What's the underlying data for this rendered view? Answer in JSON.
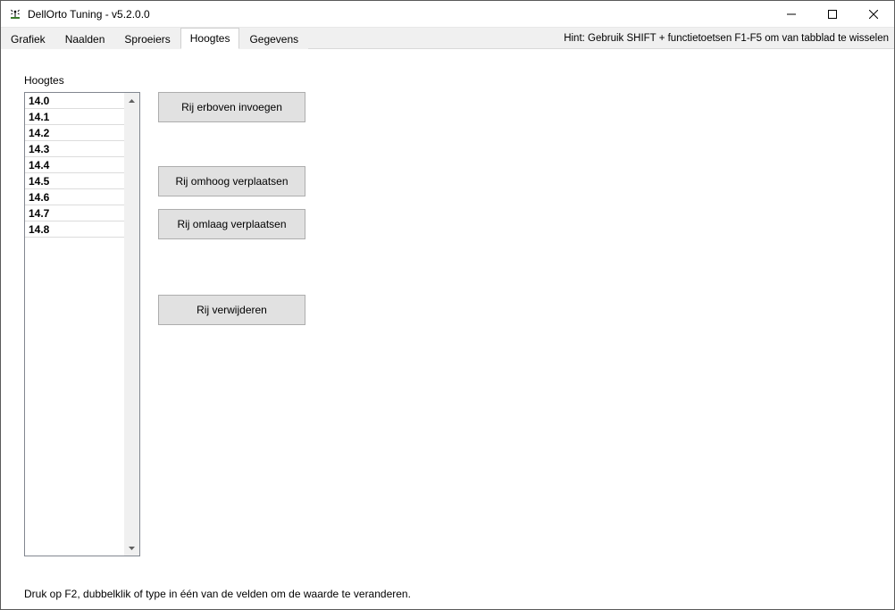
{
  "window": {
    "title": "DellOrto Tuning - v5.2.0.0"
  },
  "tabs": [
    {
      "label": "Grafiek"
    },
    {
      "label": "Naalden"
    },
    {
      "label": "Sproeiers"
    },
    {
      "label": "Hoogtes"
    },
    {
      "label": "Gegevens"
    }
  ],
  "active_tab_index": 3,
  "tab_hint": "Hint: Gebruik SHIFT + functietoetsen F1-F5 om van tabblad te wisselen",
  "section_title": "Hoogtes",
  "list_values": [
    "14.0",
    "14.1",
    "14.2",
    "14.3",
    "14.4",
    "14.5",
    "14.6",
    "14.7",
    "14.8"
  ],
  "buttons": {
    "insert_above": "Rij erboven invoegen",
    "move_up": "Rij omhoog verplaatsen",
    "move_down": "Rij omlaag verplaatsen",
    "delete_row": "Rij verwijderen"
  },
  "footer_hint": "Druk op F2, dubbelklik of type in één van de velden om de waarde te veranderen."
}
